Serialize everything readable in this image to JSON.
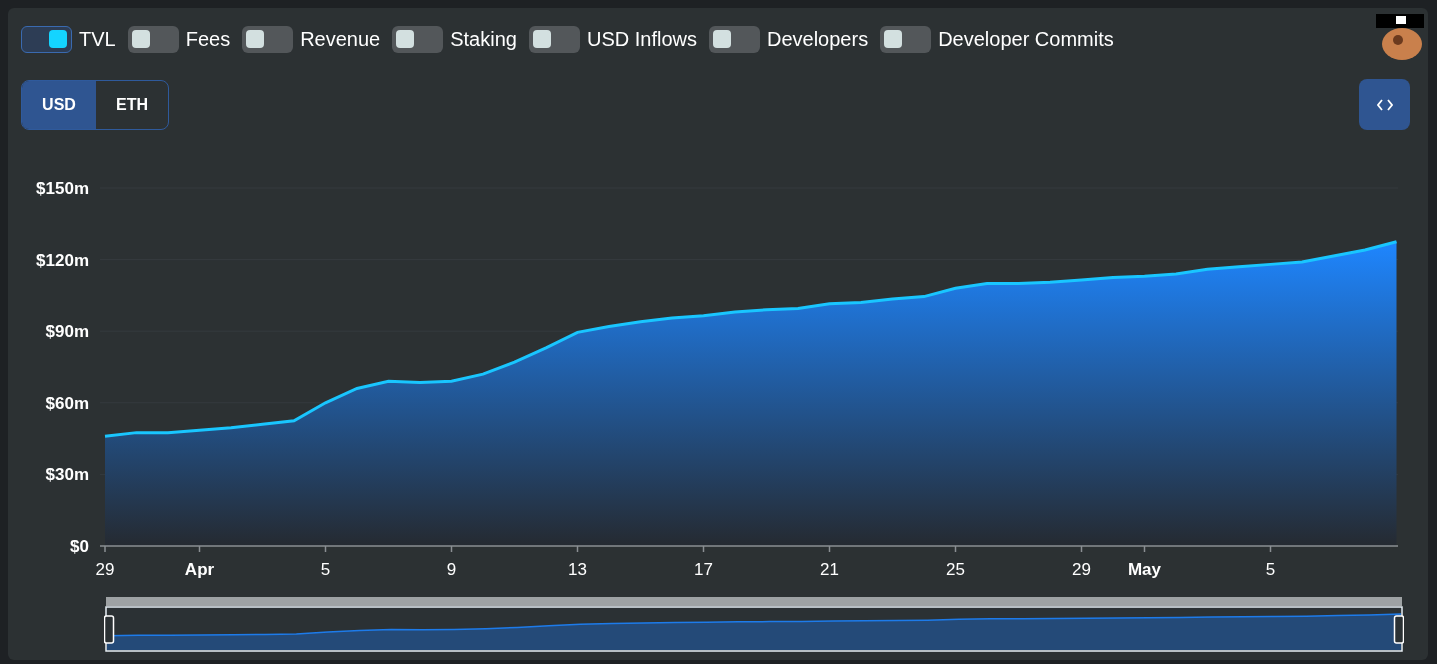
{
  "toggles": [
    {
      "label": "TVL",
      "on": true
    },
    {
      "label": "Fees",
      "on": false
    },
    {
      "label": "Revenue",
      "on": false
    },
    {
      "label": "Staking",
      "on": false
    },
    {
      "label": "USD Inflows",
      "on": false
    },
    {
      "label": "Developers",
      "on": false
    },
    {
      "label": "Developer Commits",
      "on": false
    }
  ],
  "denomination": [
    {
      "label": "USD",
      "selected": true
    },
    {
      "label": "ETH",
      "selected": false
    }
  ],
  "chart": {
    "chart_data": {
      "type": "area",
      "categories": [
        "29",
        null,
        null,
        "Apr",
        null,
        null,
        null,
        "5",
        null,
        null,
        null,
        "9",
        null,
        null,
        null,
        "13",
        null,
        null,
        null,
        "17",
        null,
        null,
        null,
        "21",
        null,
        null,
        null,
        "25",
        null,
        null,
        null,
        "29",
        null,
        "May",
        null,
        null,
        null,
        "5",
        null,
        null,
        null,
        null
      ],
      "grid": true,
      "series": [
        {
          "color": "#19c6ff",
          "values": [
            46,
            47.5,
            47.5,
            48.5,
            49.5,
            51,
            52.5,
            60,
            66,
            69,
            68.5,
            69,
            72,
            77,
            83,
            89.5,
            92,
            94,
            95.5,
            96.5,
            98,
            99,
            99.5,
            101.5,
            102,
            103.5,
            104.5,
            108,
            110,
            110,
            110.5,
            111.5,
            112.5,
            113,
            114,
            116,
            117,
            118,
            119,
            121.5,
            124,
            127.5
          ]
        }
      ],
      "ylim": [
        0,
        150
      ],
      "yticks": [
        {
          "value": 0,
          "label": "$0"
        },
        {
          "value": 30,
          "label": "$30m"
        },
        {
          "value": 60,
          "label": "$60m"
        },
        {
          "value": 90,
          "label": "$90m"
        },
        {
          "value": 120,
          "label": "$120m"
        },
        {
          "value": 150,
          "label": "$150m"
        }
      ]
    },
    "range_slider": {
      "level": 1
    }
  }
}
